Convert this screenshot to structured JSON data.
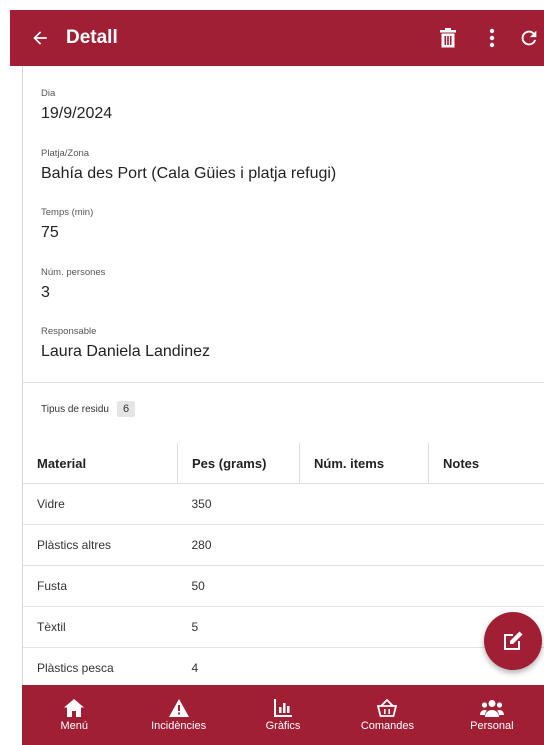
{
  "header": {
    "title": "Detall",
    "back_icon": "arrow-left-icon",
    "actions": [
      "delete-icon",
      "more-vert-icon",
      "refresh-icon"
    ],
    "color": "#a11f34"
  },
  "fields": [
    {
      "label": "Dia",
      "value": "19/9/2024"
    },
    {
      "label": "Platja/Zona",
      "value": "Bahía des Port (Cala Güies i platja refugi)"
    },
    {
      "label": "Temps (min)",
      "value": "75"
    },
    {
      "label": "Núm. persones",
      "value": "3"
    },
    {
      "label": "Responsable",
      "value": "Laura Daniela Landinez"
    }
  ],
  "tipus": {
    "label": "Tipus de residu",
    "count": "6"
  },
  "table": {
    "headers": [
      "Material",
      "Pes (grams)",
      "Núm. items",
      "Notes"
    ],
    "rows": [
      [
        "Vidre",
        "350",
        "",
        ""
      ],
      [
        "Plàstics altres",
        "280",
        "",
        ""
      ],
      [
        "Fusta",
        "50",
        "",
        ""
      ],
      [
        "Tèxtil",
        "5",
        "",
        ""
      ],
      [
        "Plàstics pesca",
        "4",
        "",
        ""
      ]
    ]
  },
  "fab": {
    "icon": "edit-icon"
  },
  "bottom_nav": [
    {
      "label": "Menú",
      "icon": "home-icon"
    },
    {
      "label": "Incidències",
      "icon": "warning-icon"
    },
    {
      "label": "Gràfics",
      "icon": "bar-chart-icon"
    },
    {
      "label": "Comandes",
      "icon": "basket-icon"
    },
    {
      "label": "Personal",
      "icon": "people-icon"
    }
  ]
}
